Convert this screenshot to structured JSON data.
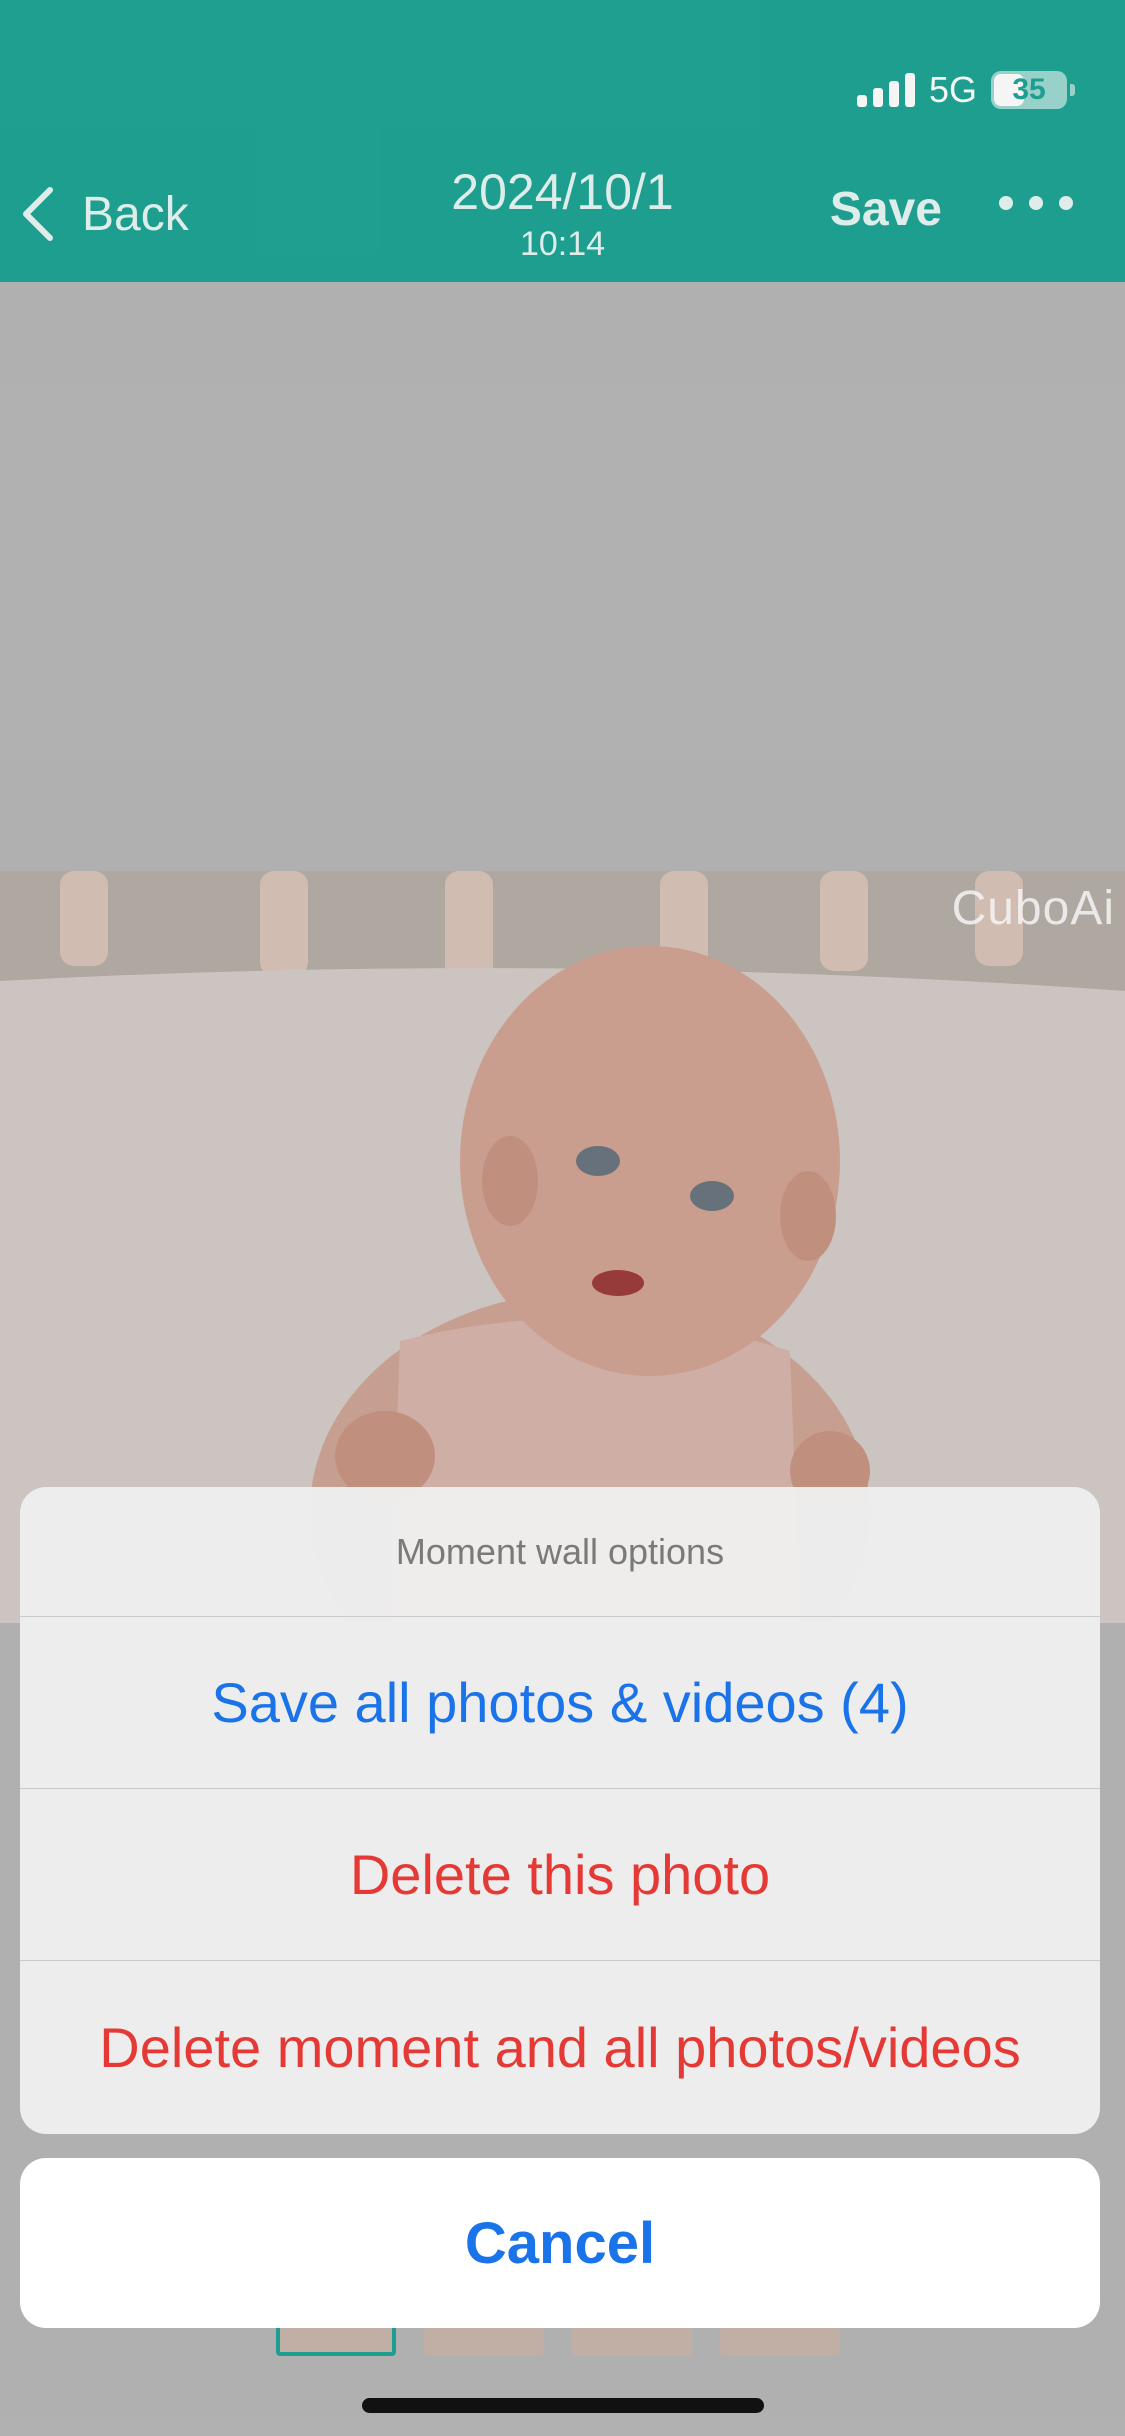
{
  "status_bar": {
    "network": "5G",
    "battery": "35"
  },
  "nav": {
    "back_label": "Back",
    "date": "2024/10/1",
    "time": "10:14",
    "save_label": "Save",
    "more_icon": "more-horizontal-icon"
  },
  "photo": {
    "watermark": "CuboAi"
  },
  "action_sheet": {
    "title": "Moment wall options",
    "options": [
      {
        "label": "Save all photos & videos (4)",
        "color": "#1a73e8"
      },
      {
        "label": "Delete this photo",
        "color": "#e53935"
      },
      {
        "label": "Delete moment and all photos/videos",
        "color": "#e53935"
      }
    ],
    "cancel_label": "Cancel"
  },
  "colors": {
    "header": "#1fa595",
    "accent_blue": "#1a73e8",
    "destructive_red": "#e53935"
  }
}
